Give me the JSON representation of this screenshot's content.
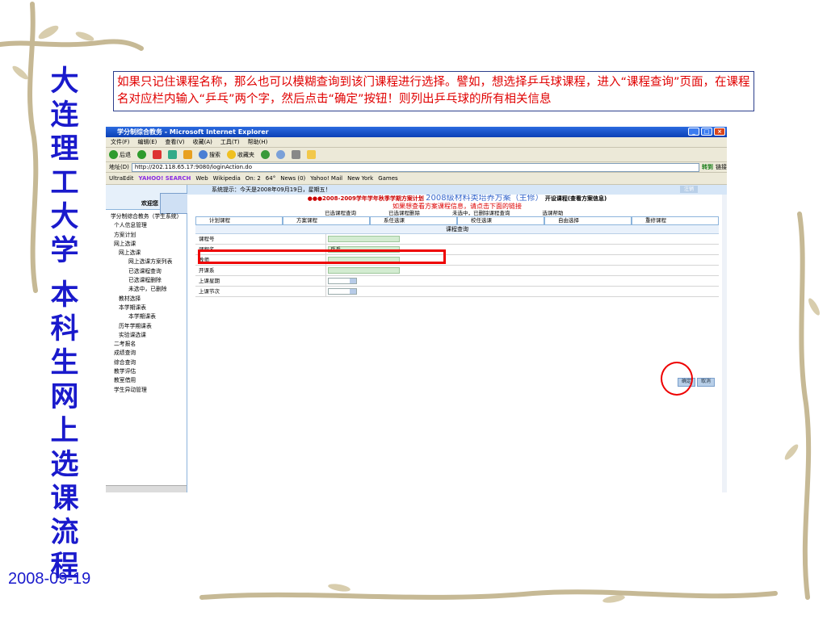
{
  "slide": {
    "vertical_title_top": "大连理工大学",
    "vertical_title_bottom": "本科生网上选课流程",
    "date": "2008-09-19",
    "caption": "如果只记住课程名称，那么也可以模糊查询到该门课程进行选择。譬如，想选择乒乓球课程，进入“课程查询”页面，在课程名对应栏内输入“乒乓”两个字，然后点击“确定”按钮！则列出乒乓球的所有相关信息",
    "accent_color": "#1a1acc",
    "highlight_color": "#e00000"
  },
  "browser": {
    "title": "学分制综合教务 - Microsoft Internet Explorer",
    "menu": [
      "文件(F)",
      "编辑(E)",
      "查看(V)",
      "收藏(A)",
      "工具(T)",
      "帮助(H)"
    ],
    "toolbar": {
      "back": "后退",
      "search": "搜索",
      "favorites": "收藏夹"
    },
    "address_label": "地址(D)",
    "address_value": "http://202.118.65.17:9080/loginAction.do",
    "go_label": "转到",
    "links_label": "链接",
    "links_bar": [
      "UltraEdit",
      "YAHOO! SEARCH",
      "Web",
      "Wikipedia",
      "On: 2",
      "64°",
      "News (0)",
      "Yahoo! Mail",
      "New York",
      "Games"
    ]
  },
  "left_pane": {
    "welcome": "欢迎您",
    "tree": [
      "学分制综合教务（学生系统）",
      "个人信息管理",
      "方案计划",
      "网上选课",
      "网上选课",
      "网上选课方案列表",
      "已选课程查询",
      "已选课程删除",
      "未选中，已删除",
      "教材选择",
      "本学期课表",
      "本学期课表",
      "历年学期课表",
      "实验课选课",
      "二考报名",
      "成绩查询",
      "综合查询",
      "教学评估",
      "教室借用",
      "学生异动管理"
    ]
  },
  "right_pane": {
    "system_tip": "系统提示：今天是2008年09月19日，星期五！",
    "logout": "注销",
    "plan_prefix": "●●●2008-2009学年学年秋季学期方案计划",
    "plan_title": "2008级材料类培养方案（主修）",
    "plan_suffix": "开设课程(查看方案信息)",
    "red_hint": "如果想查看方案课程信息，请点击下面的链接",
    "sub_links": [
      "已选课程查询",
      "已选课程删除",
      "未选中，已删除课程查询",
      "选课帮助"
    ],
    "tabs": [
      "计划课程",
      "方案课程",
      "系任选课",
      "校任选课",
      "自由选择",
      "重修课程"
    ],
    "query_title": "课程查询",
    "rows": [
      {
        "label": "课程号",
        "value": "",
        "type": "input"
      },
      {
        "label": "课程名",
        "value": "乒乓",
        "type": "input"
      },
      {
        "label": "教师",
        "value": "",
        "type": "input"
      },
      {
        "label": "开课系",
        "value": "",
        "type": "input"
      },
      {
        "label": "上课星期",
        "value": "",
        "type": "select"
      },
      {
        "label": "上课节次",
        "value": "",
        "type": "select"
      }
    ],
    "ok_label": "确定",
    "cancel_label": "取消"
  }
}
